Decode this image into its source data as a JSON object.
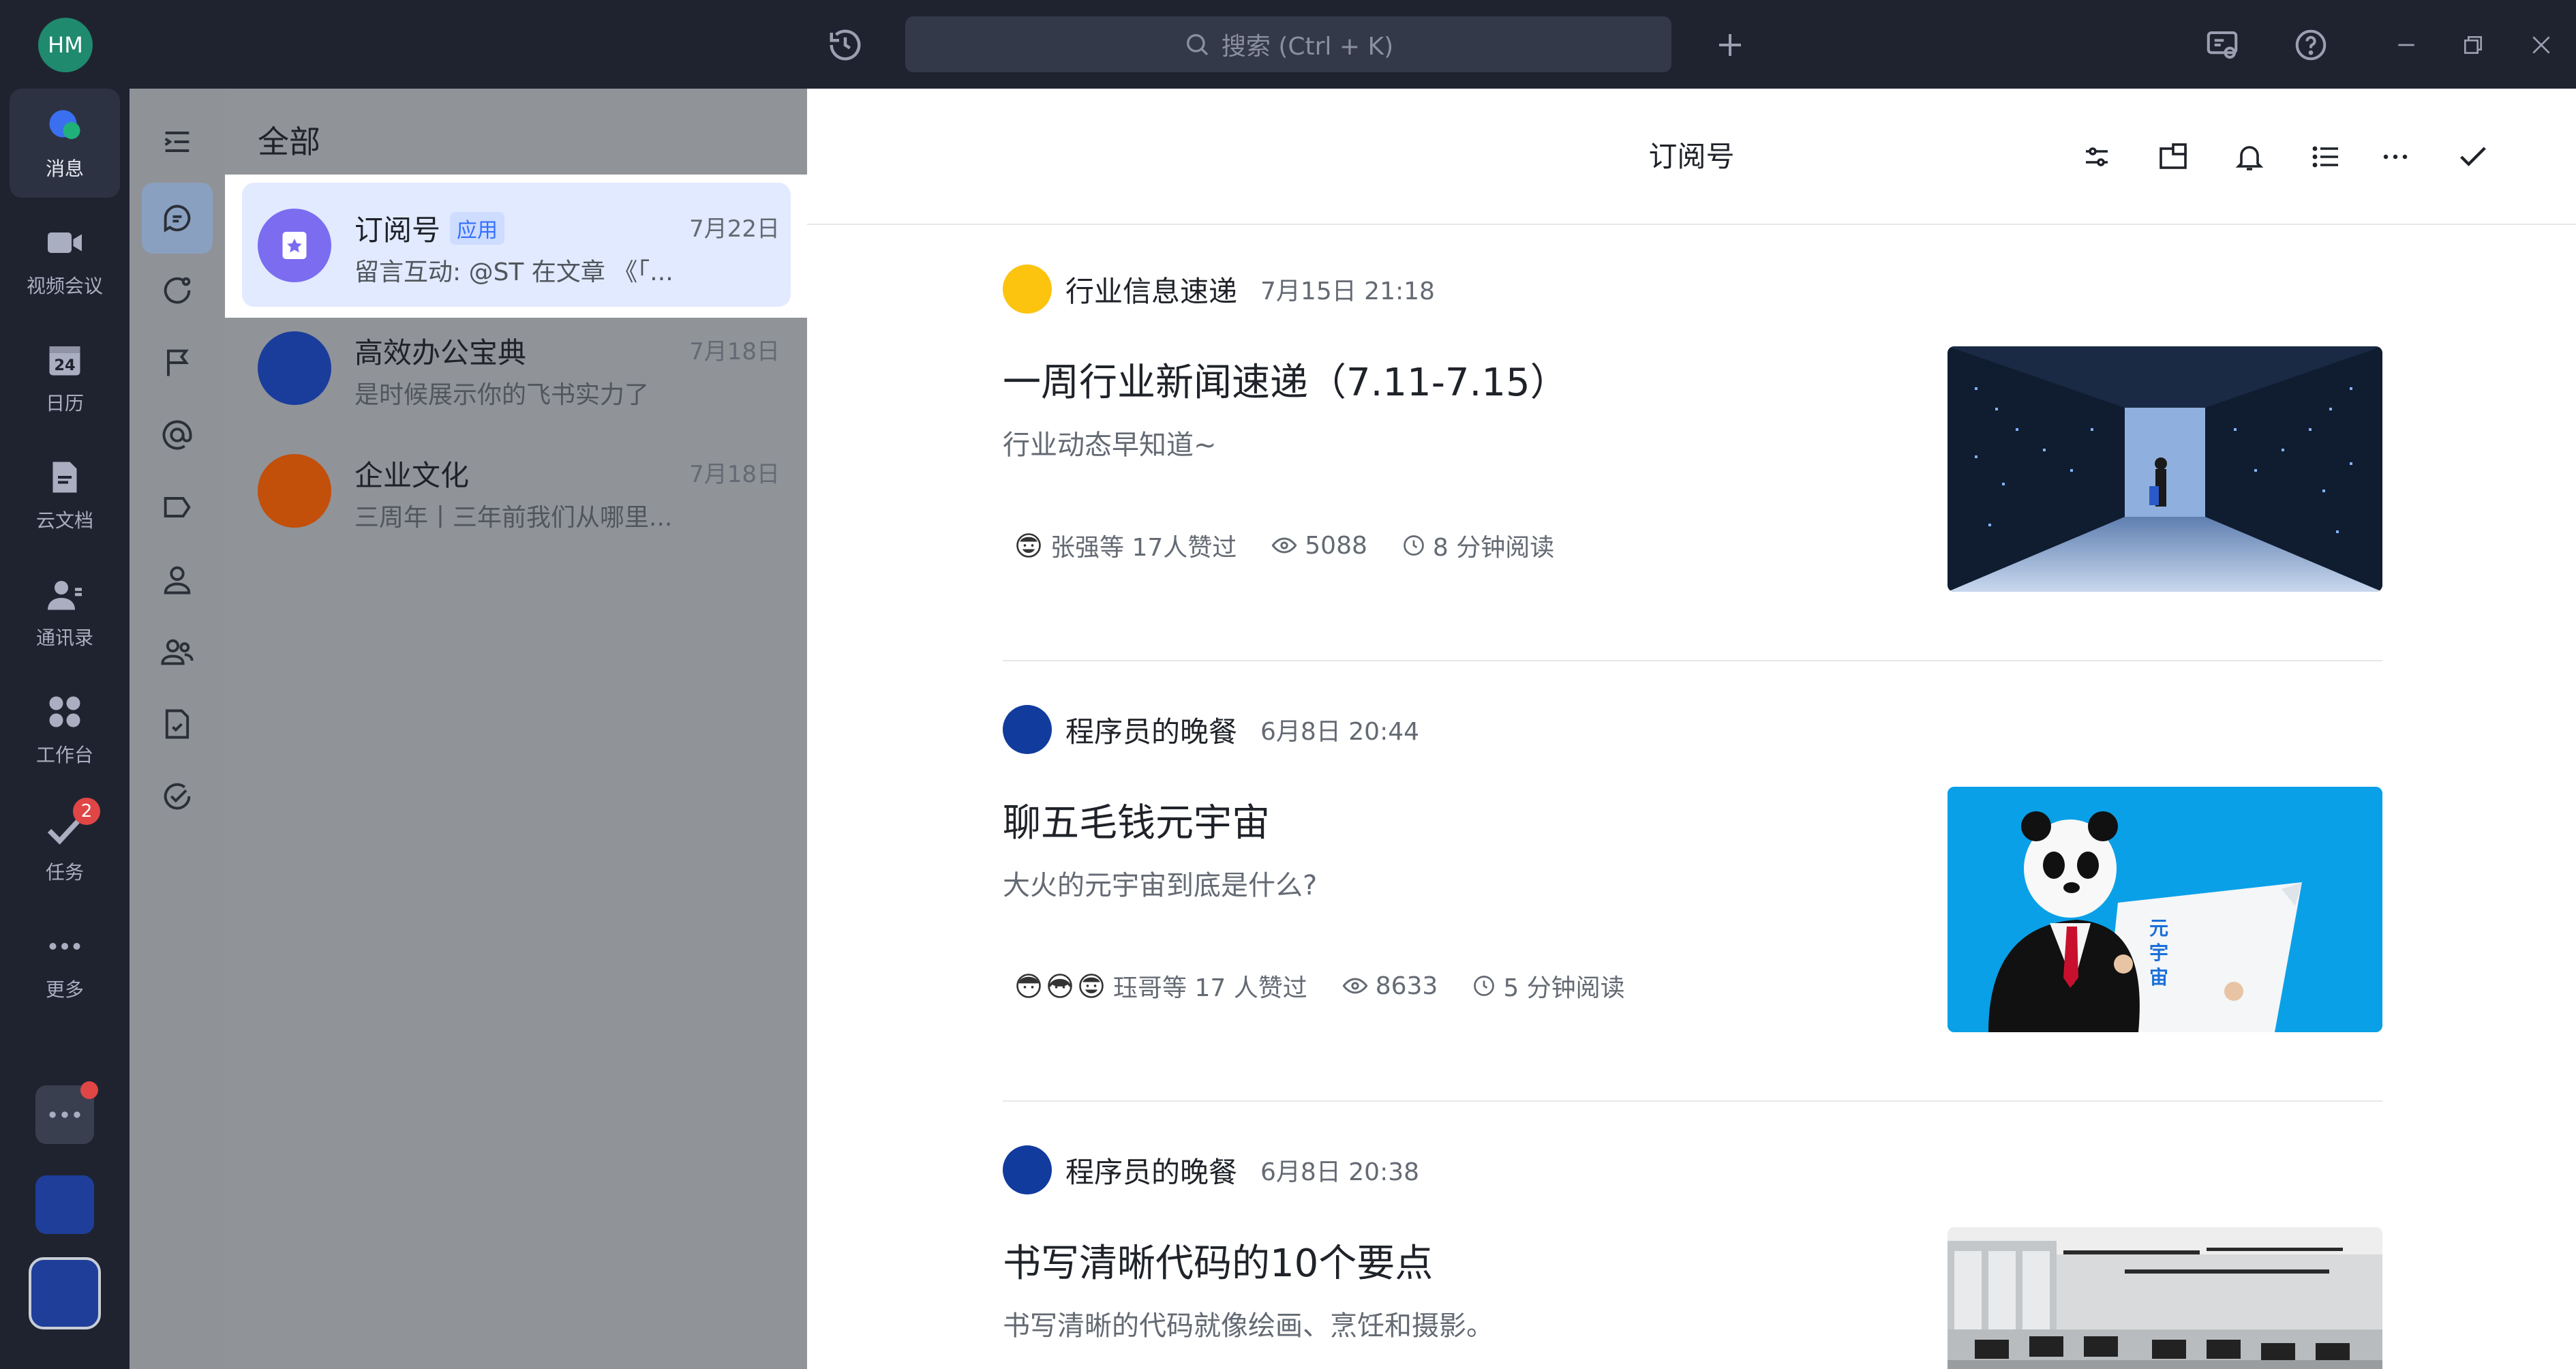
{
  "topbar": {
    "user_initials": "HM",
    "search_placeholder": "搜索 (Ctrl + K)"
  },
  "dock": {
    "items": [
      {
        "label": "消息",
        "icon": "chat-bubble-icon",
        "active": true
      },
      {
        "label": "视频会议",
        "icon": "video-camera-icon"
      },
      {
        "label": "日历",
        "icon": "calendar-icon"
      },
      {
        "label": "云文档",
        "icon": "cloud-doc-icon"
      },
      {
        "label": "通讯录",
        "icon": "contacts-icon"
      },
      {
        "label": "工作台",
        "icon": "workspace-grid-icon"
      },
      {
        "label": "任务",
        "icon": "task-check-icon",
        "badge": "2"
      },
      {
        "label": "更多",
        "icon": "more-dots-icon"
      }
    ],
    "calendar_day": "24"
  },
  "chatlist": {
    "header": "全部",
    "chats": [
      {
        "name": "订阅号",
        "tag": "应用",
        "date": "7月22日",
        "preview": "留言互动: @ST 在文章 《「...",
        "color": "#7b6cf0",
        "selected": true
      },
      {
        "name": "高效办公宝典",
        "tag": "",
        "date": "7月18日",
        "preview": "是时候展示你的飞书实力了",
        "color": "#1a3d9c"
      },
      {
        "name": "企业文化",
        "tag": "",
        "date": "7月18日",
        "preview": "三周年丨三年前我们从哪里...",
        "color": "#c24f0a"
      }
    ]
  },
  "main": {
    "title": "订阅号",
    "articles": [
      {
        "source": "行业信息速递",
        "time": "7月15日 21:18",
        "source_color": "#fcc40f",
        "title": "一周行业新闻速递（7.11-7.15）",
        "subtitle": "行业动态早知道~",
        "likes": "张强等 17人赞过",
        "views": "5088",
        "read": "8 分钟阅读",
        "thumb": "datacenter"
      },
      {
        "source": "程序员的晚餐",
        "time": "6月8日 20:44",
        "source_color": "#123b9e",
        "title": "聊五毛钱元宇宙",
        "subtitle": "大火的元宇宙到底是什么?",
        "likes": "珏哥等 17 人赞过",
        "views": "8633",
        "read": "5 分钟阅读",
        "thumb": "panda",
        "thumb_text": "元宇宙"
      },
      {
        "source": "程序员的晚餐",
        "time": "6月8日 20:38",
        "source_color": "#123b9e",
        "title": "书写清晰代码的10个要点",
        "subtitle": "书写清晰的代码就像绘画、烹饪和摄影。",
        "thumb": "office"
      }
    ]
  }
}
